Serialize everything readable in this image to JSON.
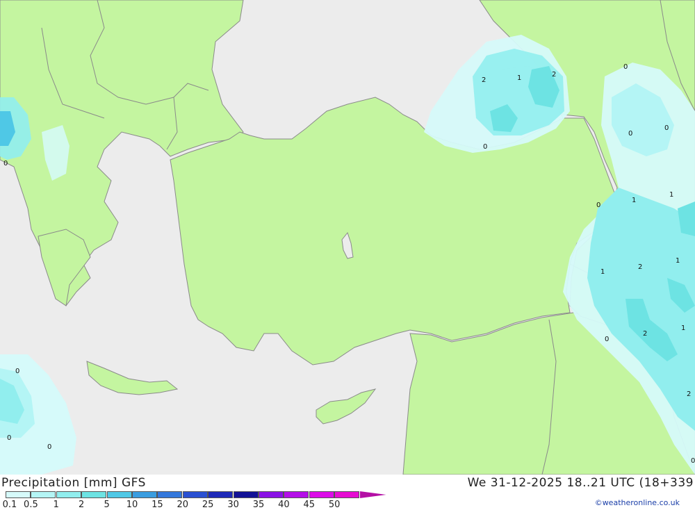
{
  "footer": {
    "title": "Precipitation [mm] GFS",
    "valid_time": "We 31-12-2025 18..21 UTC (18+339",
    "credit": "©weatheronline.co.uk"
  },
  "legend": {
    "ticks": [
      "0.1",
      "0.5",
      "1",
      "2",
      "5",
      "10",
      "15",
      "20",
      "25",
      "30",
      "35",
      "40",
      "45",
      "50"
    ],
    "colors": [
      "#d6fafa",
      "#b4f5f5",
      "#91eeee",
      "#6de3e3",
      "#4fc8e6",
      "#3a9de0",
      "#3478dc",
      "#2a50d2",
      "#1e2ab8",
      "#121296",
      "#8a12e6",
      "#b40fe8",
      "#dc0ce8",
      "#e60cd2",
      "#b40fa5"
    ]
  },
  "map_labels": [
    {
      "text": "2"
    },
    {
      "text": "1"
    },
    {
      "text": "2"
    },
    {
      "text": "0"
    },
    {
      "text": "0"
    },
    {
      "text": "0"
    },
    {
      "text": "0"
    },
    {
      "text": "0"
    },
    {
      "text": "1"
    },
    {
      "text": "1"
    },
    {
      "text": "1"
    },
    {
      "text": "2"
    },
    {
      "text": "1"
    },
    {
      "text": "0"
    },
    {
      "text": "2"
    },
    {
      "text": "1"
    },
    {
      "text": "2"
    },
    {
      "text": "0"
    },
    {
      "text": "0"
    },
    {
      "text": "0"
    },
    {
      "text": "0"
    },
    {
      "text": "0"
    }
  ]
}
